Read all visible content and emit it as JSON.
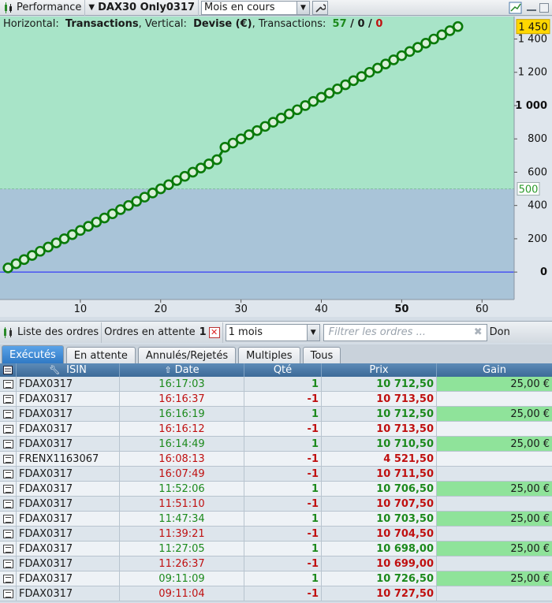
{
  "toolbar": {
    "performance_label": "Performance",
    "system_name": "DAX30 Only0317",
    "period_value": "Mois en cours",
    "settings_icon": "wrench-icon",
    "chart_icon": "chart-edit-icon"
  },
  "chart_info": {
    "horizontal_label": "Horizontal:",
    "horizontal_value": "Transactions",
    "vertical_label": ", Vertical:",
    "vertical_value": "Devise (€)",
    "transactions_label": ", Transactions:",
    "count_total": "57",
    "sep1": " / ",
    "count_zero": "0",
    "sep2": " / ",
    "count_loss": "0"
  },
  "chart_data": {
    "type": "line",
    "xlabel": "",
    "ylabel": "",
    "x_ticks": [
      "10",
      "20",
      "30",
      "40",
      "50",
      "60"
    ],
    "y_ticks": [
      "0",
      "200",
      "400",
      "600",
      "800",
      "1 000",
      "1 200",
      "1 400"
    ],
    "xlim": [
      0,
      64
    ],
    "ylim": [
      -165,
      1535
    ],
    "current_value_label": "1 450",
    "reference_label": "500",
    "reference_value": 500,
    "zero_line": 0,
    "series": [
      {
        "x": [
          1,
          2,
          3,
          4,
          5,
          6,
          7,
          8,
          9,
          10,
          11,
          12,
          13,
          14,
          15,
          16,
          17,
          18,
          19,
          20,
          21,
          22,
          23,
          24,
          25,
          26,
          27,
          28,
          29,
          30,
          31,
          32,
          33,
          34,
          35,
          36,
          37,
          38,
          39,
          40,
          41,
          42,
          43,
          44,
          45,
          46,
          47,
          48,
          49,
          50,
          51,
          52,
          53,
          54,
          55,
          56,
          57
        ],
        "y": [
          25,
          50,
          75,
          100,
          125,
          150,
          175,
          200,
          225,
          250,
          275,
          300,
          325,
          350,
          375,
          400,
          425,
          450,
          475,
          500,
          525,
          550,
          575,
          600,
          625,
          650,
          675,
          750,
          775,
          800,
          825,
          850,
          875,
          900,
          925,
          950,
          975,
          1000,
          1025,
          1050,
          1075,
          1100,
          1125,
          1150,
          1175,
          1200,
          1225,
          1250,
          1275,
          1300,
          1325,
          1350,
          1375,
          1400,
          1425,
          1450,
          1475
        ]
      }
    ]
  },
  "orders_bar": {
    "list_label": "Liste des ordres",
    "pending_label": "Ordres en attente",
    "pending_count": "1",
    "period_value": "1 mois",
    "filter_placeholder": "Filtrer les ordres ...",
    "truncated_label": "Don"
  },
  "tabs": [
    {
      "label": "Exécutés"
    },
    {
      "label": "En attente"
    },
    {
      "label": "Annulés/Rejetés"
    },
    {
      "label": "Multiples"
    },
    {
      "label": "Tous"
    }
  ],
  "table": {
    "headers": {
      "isin": "ISIN",
      "date": "Date",
      "qte": "Qté",
      "prix": "Prix",
      "gain": "Gain"
    },
    "rows": [
      {
        "isin": "FDAX0317",
        "date": "16:17:03",
        "qte": "1",
        "prix": "10 712,50",
        "gain": "25,00 €",
        "side": "buy"
      },
      {
        "isin": "FDAX0317",
        "date": "16:16:37",
        "qte": "-1",
        "prix": "10 713,50",
        "gain": "",
        "side": "sell"
      },
      {
        "isin": "FDAX0317",
        "date": "16:16:19",
        "qte": "1",
        "prix": "10 712,50",
        "gain": "25,00 €",
        "side": "buy"
      },
      {
        "isin": "FDAX0317",
        "date": "16:16:12",
        "qte": "-1",
        "prix": "10 713,50",
        "gain": "",
        "side": "sell"
      },
      {
        "isin": "FDAX0317",
        "date": "16:14:49",
        "qte": "1",
        "prix": "10 710,50",
        "gain": "25,00 €",
        "side": "buy"
      },
      {
        "isin": "FRENX1163067",
        "date": "16:08:13",
        "qte": "-1",
        "prix": "4 521,50",
        "gain": "",
        "side": "sell"
      },
      {
        "isin": "FDAX0317",
        "date": "16:07:49",
        "qte": "-1",
        "prix": "10 711,50",
        "gain": "",
        "side": "sell"
      },
      {
        "isin": "FDAX0317",
        "date": "11:52:06",
        "qte": "1",
        "prix": "10 706,50",
        "gain": "25,00 €",
        "side": "buy"
      },
      {
        "isin": "FDAX0317",
        "date": "11:51:10",
        "qte": "-1",
        "prix": "10 707,50",
        "gain": "",
        "side": "sell"
      },
      {
        "isin": "FDAX0317",
        "date": "11:47:34",
        "qte": "1",
        "prix": "10 703,50",
        "gain": "25,00 €",
        "side": "buy"
      },
      {
        "isin": "FDAX0317",
        "date": "11:39:21",
        "qte": "-1",
        "prix": "10 704,50",
        "gain": "",
        "side": "sell"
      },
      {
        "isin": "FDAX0317",
        "date": "11:27:05",
        "qte": "1",
        "prix": "10 698,00",
        "gain": "25,00 €",
        "side": "buy"
      },
      {
        "isin": "FDAX0317",
        "date": "11:26:37",
        "qte": "-1",
        "prix": "10 699,00",
        "gain": "",
        "side": "sell"
      },
      {
        "isin": "FDAX0317",
        "date": "09:11:09",
        "qte": "1",
        "prix": "10 726,50",
        "gain": "25,00 €",
        "side": "buy"
      },
      {
        "isin": "FDAX0317",
        "date": "09:11:04",
        "qte": "-1",
        "prix": "10 727,50",
        "gain": "",
        "side": "sell"
      }
    ]
  },
  "colors": {
    "chart_bg_upper": "#a8e4c8",
    "chart_bg_lower": "#a9c4d8",
    "equity_line": "#0a7a0a",
    "zero_line": "#1a1aff",
    "gain_positive": "#8fe39a",
    "buy_text": "#1c8a1c",
    "sell_text": "#c01010"
  }
}
